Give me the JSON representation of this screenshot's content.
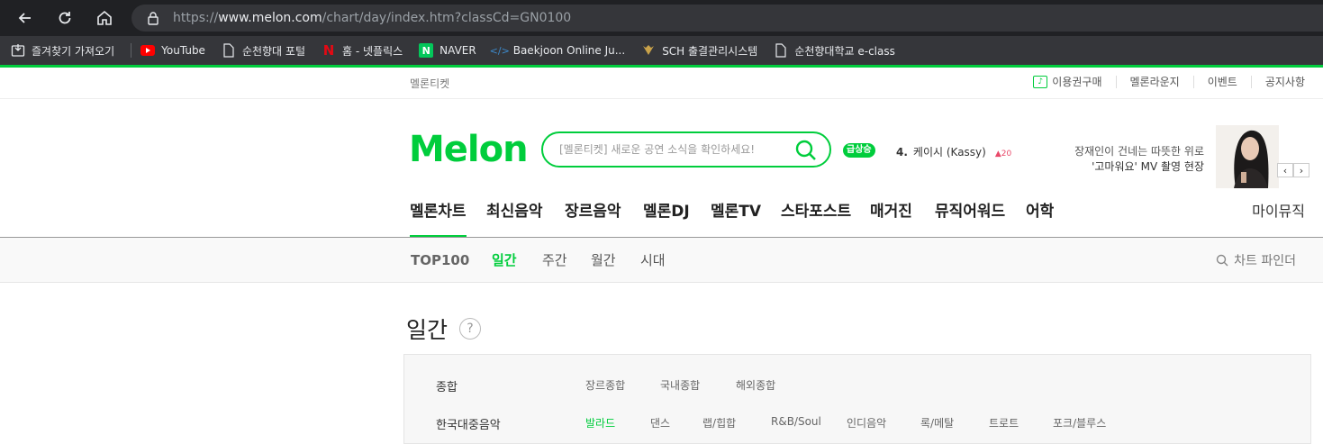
{
  "browser": {
    "url_prefix": "https://",
    "url_host": "www.melon.com",
    "url_path": "/chart/day/index.htm?classCd=GN0100",
    "bookmarks": [
      {
        "label": "즐겨찾기 가져오기",
        "icon": "import-bookmarks-icon"
      },
      {
        "label": "YouTube",
        "icon": "youtube-icon"
      },
      {
        "label": "순천향대 포털",
        "icon": "page-icon"
      },
      {
        "label": "홈 - 넷플릭스",
        "icon": "netflix-icon"
      },
      {
        "label": "NAVER",
        "icon": "naver-icon"
      },
      {
        "label": "Baekjoon Online Ju...",
        "icon": "baekjoon-icon"
      },
      {
        "label": "SCH 출결관리시스템",
        "icon": "sch-icon"
      },
      {
        "label": "순천향대학교 e-class",
        "icon": "page-icon"
      }
    ]
  },
  "util": {
    "ticket": "멜론티켓",
    "links": [
      "이용권구매",
      "멜론라운지",
      "이벤트",
      "공지사항"
    ]
  },
  "header": {
    "logo": "Melon",
    "search_placeholder": "[멜론티켓] 새로운 공연 소식을 확인하세요!",
    "hot_badge": "급상승",
    "hot_rank": "4.",
    "hot_title": "케이시 (Kassy)",
    "hot_delta": "20",
    "banner_line1": "장재인이 건네는 따뜻한 위로",
    "banner_line2": "'고마워요' MV 촬영 현장"
  },
  "gnb": {
    "items": [
      "멜론차트",
      "최신음악",
      "장르음악",
      "멜론DJ",
      "멜론TV",
      "스타포스트",
      "매거진",
      "뮤직어워드",
      "어학"
    ],
    "mymusic": "마이뮤직"
  },
  "subnav": {
    "items": [
      "TOP100",
      "일간",
      "주간",
      "월간",
      "시대"
    ],
    "active": "일간",
    "finder": "차트 파인더"
  },
  "page": {
    "title": "일간",
    "help": "?"
  },
  "genres": {
    "row1_label": "종합",
    "row1_opts": [
      "장르종합",
      "국내종합",
      "해외종합"
    ],
    "row2_label": "한국대중음악",
    "row2_opts": [
      "발라드",
      "댄스",
      "랩/힙합",
      "R&B/Soul",
      "인디음악",
      "록/메탈",
      "트로트",
      "포크/블루스"
    ],
    "row2_active": "발라드"
  },
  "colors": {
    "accent": "#00cd3c",
    "chrome_dark": "#202124",
    "delta_up": "#e94a6a"
  }
}
